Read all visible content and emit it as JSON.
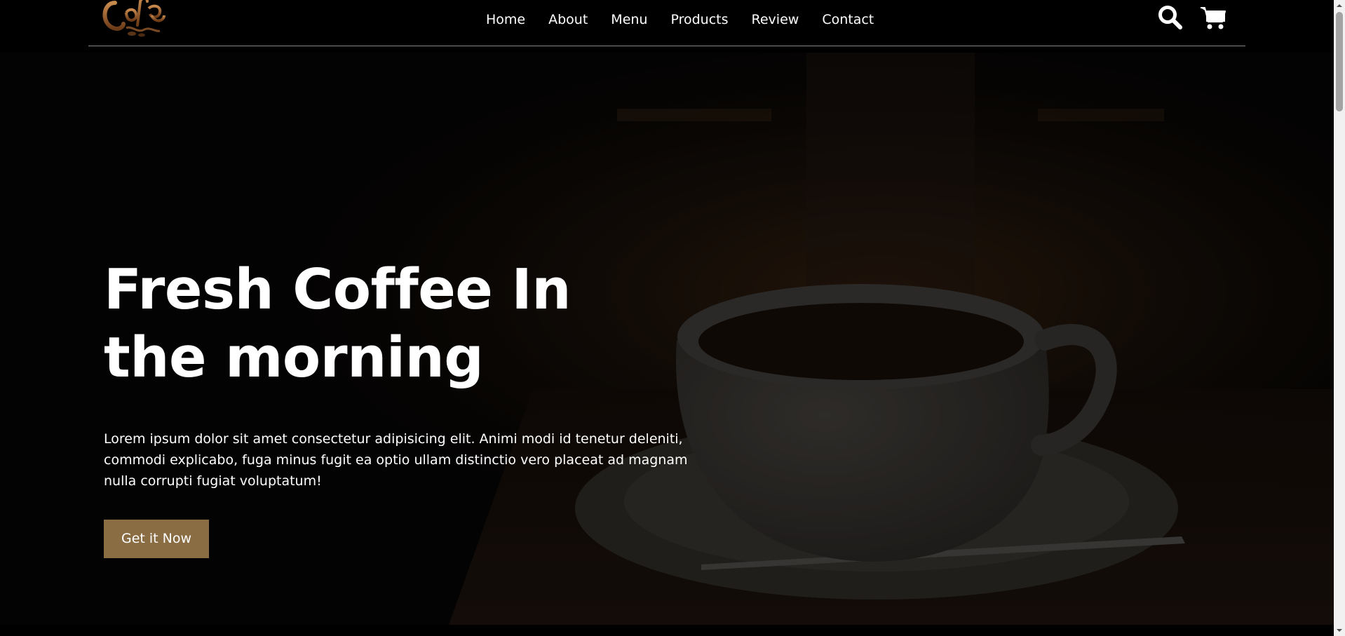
{
  "header": {
    "logo_text": "Coffee",
    "nav": [
      "Home",
      "About",
      "Menu",
      "Products",
      "Review",
      "Contact"
    ],
    "icons": [
      "search-icon",
      "cart-icon"
    ]
  },
  "hero": {
    "title": "Fresh Coffee In the morning",
    "text": "Lorem ipsum dolor sit amet consectetur adipisicing elit. Animi modi id tenetur deleniti, commodi explicabo, fuga minus fugit ea optio ullam distinctio vero placeat ad magnam nulla corrupti fugiat voluptatum!",
    "button_label": "Get it Now"
  },
  "colors": {
    "accent": "#8b6d44",
    "background": "#000000",
    "text": "#ffffff"
  }
}
